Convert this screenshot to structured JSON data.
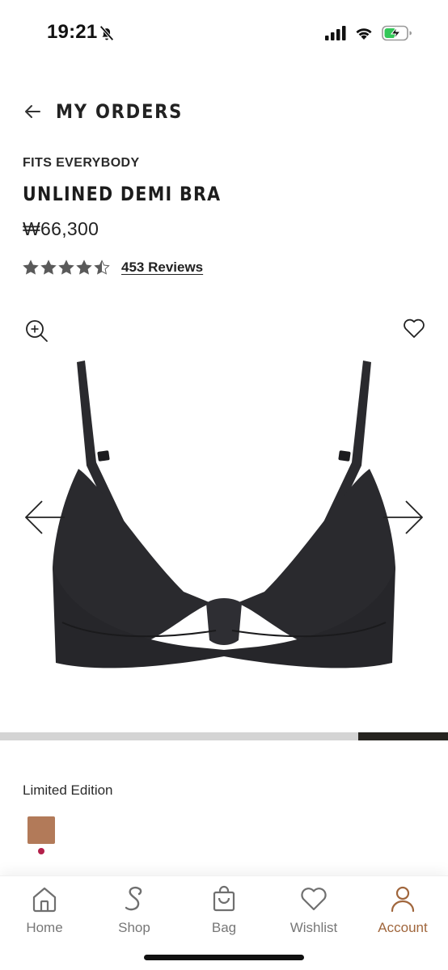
{
  "status": {
    "time": "19:21",
    "icons": [
      "bell-off-icon",
      "cellular-signal-icon",
      "wifi-icon",
      "battery-charging-icon"
    ]
  },
  "header": {
    "back_title": "MY ORDERS",
    "icon": "arrow-left-icon"
  },
  "product": {
    "brand_line": "FITS EVERYBODY",
    "name": "UNLINED DEMI BRA",
    "price": "₩66,300",
    "rating": 4.5,
    "max_rating": 5,
    "reviews_label": "453 Reviews"
  },
  "gallery": {
    "icons": [
      "zoom-in-icon",
      "heart-icon",
      "chevron-left-arrow-icon",
      "chevron-right-arrow-icon"
    ],
    "image_color": "#2a2a2e",
    "progress_fraction": 0.2
  },
  "variant": {
    "edition_label": "Limited Edition",
    "swatch_color": "#b27a59",
    "selected_dot_color": "#b3204a"
  },
  "tab_bar": {
    "active_color": "#a0663c",
    "items": [
      {
        "label": "Home",
        "icon": "home-icon"
      },
      {
        "label": "Shop",
        "icon": "shop-s-icon"
      },
      {
        "label": "Bag",
        "icon": "bag-icon"
      },
      {
        "label": "Wishlist",
        "icon": "heart-icon"
      },
      {
        "label": "Account",
        "icon": "person-icon"
      }
    ],
    "active_index": 4
  }
}
